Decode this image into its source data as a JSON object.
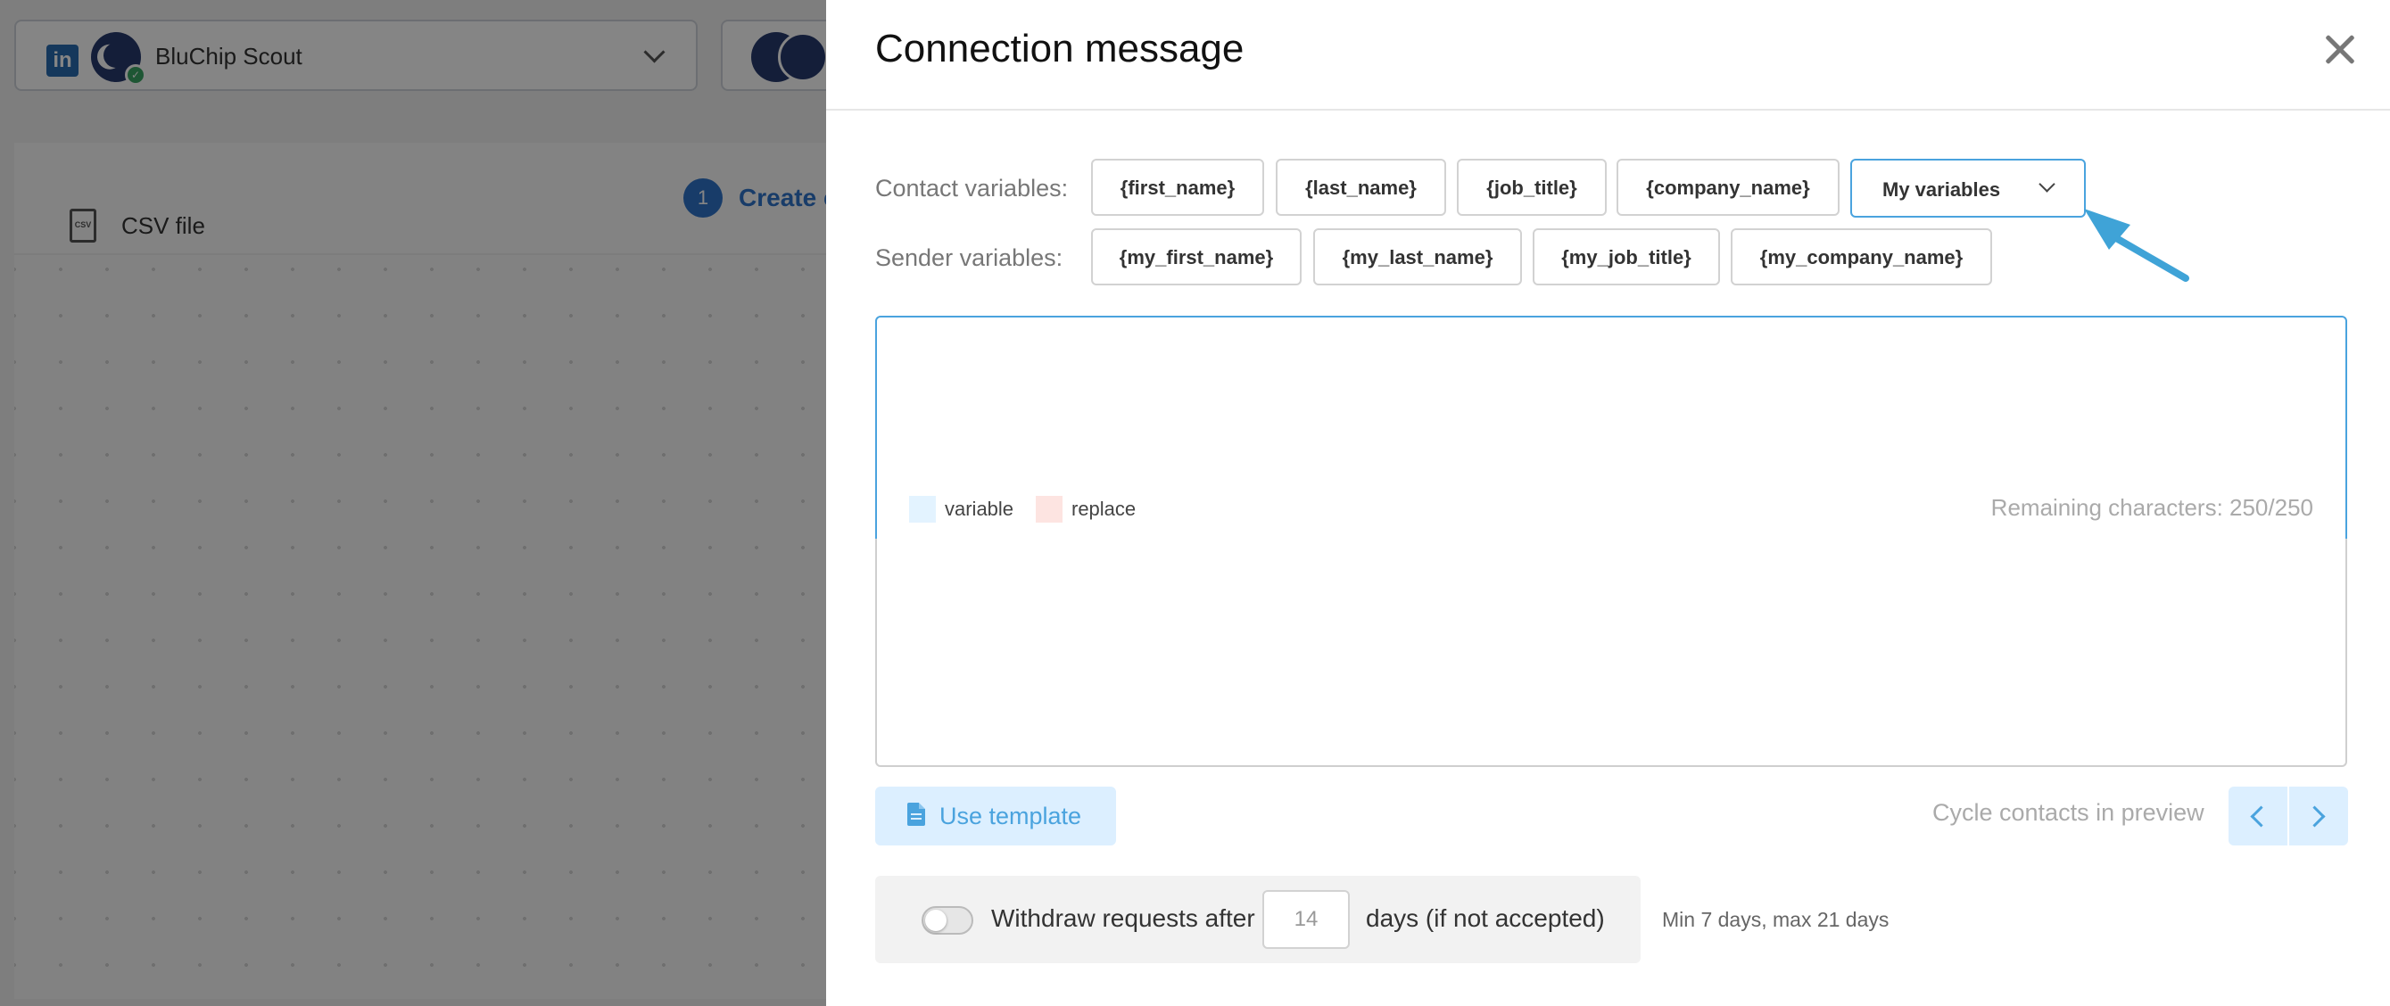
{
  "background": {
    "account_name": "BluChip Scout",
    "linkedin_icon": "linkedin-icon",
    "csv_label": "CSV file",
    "step_number": "1",
    "step_label": "Create campaign"
  },
  "modal": {
    "title": "Connection message",
    "contact_variables_label": "Contact variables:",
    "contact_variables": [
      "{first_name}",
      "{last_name}",
      "{job_title}",
      "{company_name}"
    ],
    "my_variables_label": "My variables",
    "sender_variables_label": "Sender variables:",
    "sender_variables": [
      "{my_first_name}",
      "{my_last_name}",
      "{my_job_title}",
      "{my_company_name}"
    ],
    "editor": {
      "value": "",
      "legend_variable": "variable",
      "legend_replace": "replace",
      "remaining": "Remaining characters: 250/250"
    },
    "use_template_label": "Use template",
    "cycle_label": "Cycle contacts in preview",
    "withdraw": {
      "label": "Withdraw requests after",
      "days": "14",
      "suffix": "days (if not accepted)",
      "enabled": false
    },
    "min_max_label": "Min 7 days, max 21 days"
  },
  "colors": {
    "accent": "#4aa3de",
    "accent_light": "#dcefff",
    "variable_swatch": "#e3f3ff",
    "replace_swatch": "#fde4e1",
    "arrow": "#3fa3d7"
  }
}
